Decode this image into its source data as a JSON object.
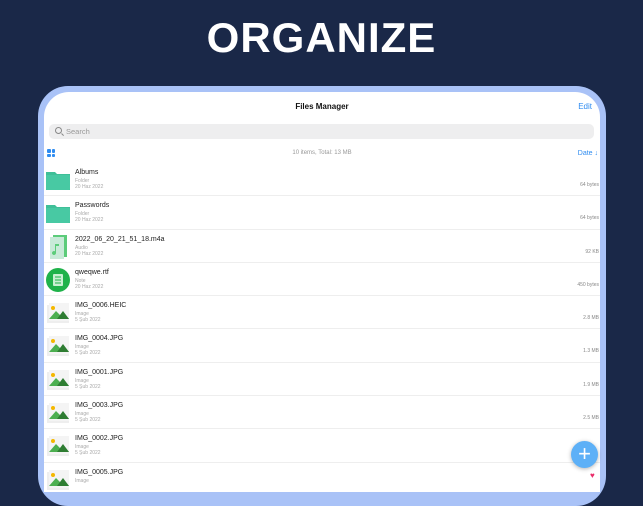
{
  "headline": "ORGANIZE",
  "nav": {
    "title": "Files Manager",
    "edit": "Edit"
  },
  "search": {
    "placeholder": "Search"
  },
  "summary": "10 items, Total: 13 MB",
  "sort": "Date ↓",
  "files": [
    {
      "name": "Albums",
      "type": "Folder",
      "date": "20 Haz 2022",
      "size": "64 bytes",
      "icon": "folder"
    },
    {
      "name": "Passwords",
      "type": "Folder",
      "date": "20 Haz 2022",
      "size": "64 bytes",
      "icon": "folder"
    },
    {
      "name": "2022_06_20_21_51_18.m4a",
      "type": "Audio",
      "date": "20 Haz 2022",
      "size": "92 KB",
      "icon": "audio"
    },
    {
      "name": "qweqwe.rtf",
      "type": "Note",
      "date": "20 Haz 2022",
      "size": "450 bytes",
      "icon": "note"
    },
    {
      "name": "IMG_0006.HEIC",
      "type": "Image",
      "date": "5 Şub 2022",
      "size": "2.8 MB",
      "icon": "image"
    },
    {
      "name": "IMG_0004.JPG",
      "type": "Image",
      "date": "5 Şub 2022",
      "size": "1.3 MB",
      "icon": "image"
    },
    {
      "name": "IMG_0001.JPG",
      "type": "Image",
      "date": "5 Şub 2022",
      "size": "1.9 MB",
      "icon": "image"
    },
    {
      "name": "IMG_0003.JPG",
      "type": "Image",
      "date": "5 Şub 2022",
      "size": "2.5 MB",
      "icon": "image"
    },
    {
      "name": "IMG_0002.JPG",
      "type": "Image",
      "date": "5 Şub 2022",
      "size": "",
      "icon": "image"
    },
    {
      "name": "IMG_0005.JPG",
      "type": "Image",
      "date": "",
      "size": "",
      "icon": "image"
    }
  ],
  "fab": "+"
}
